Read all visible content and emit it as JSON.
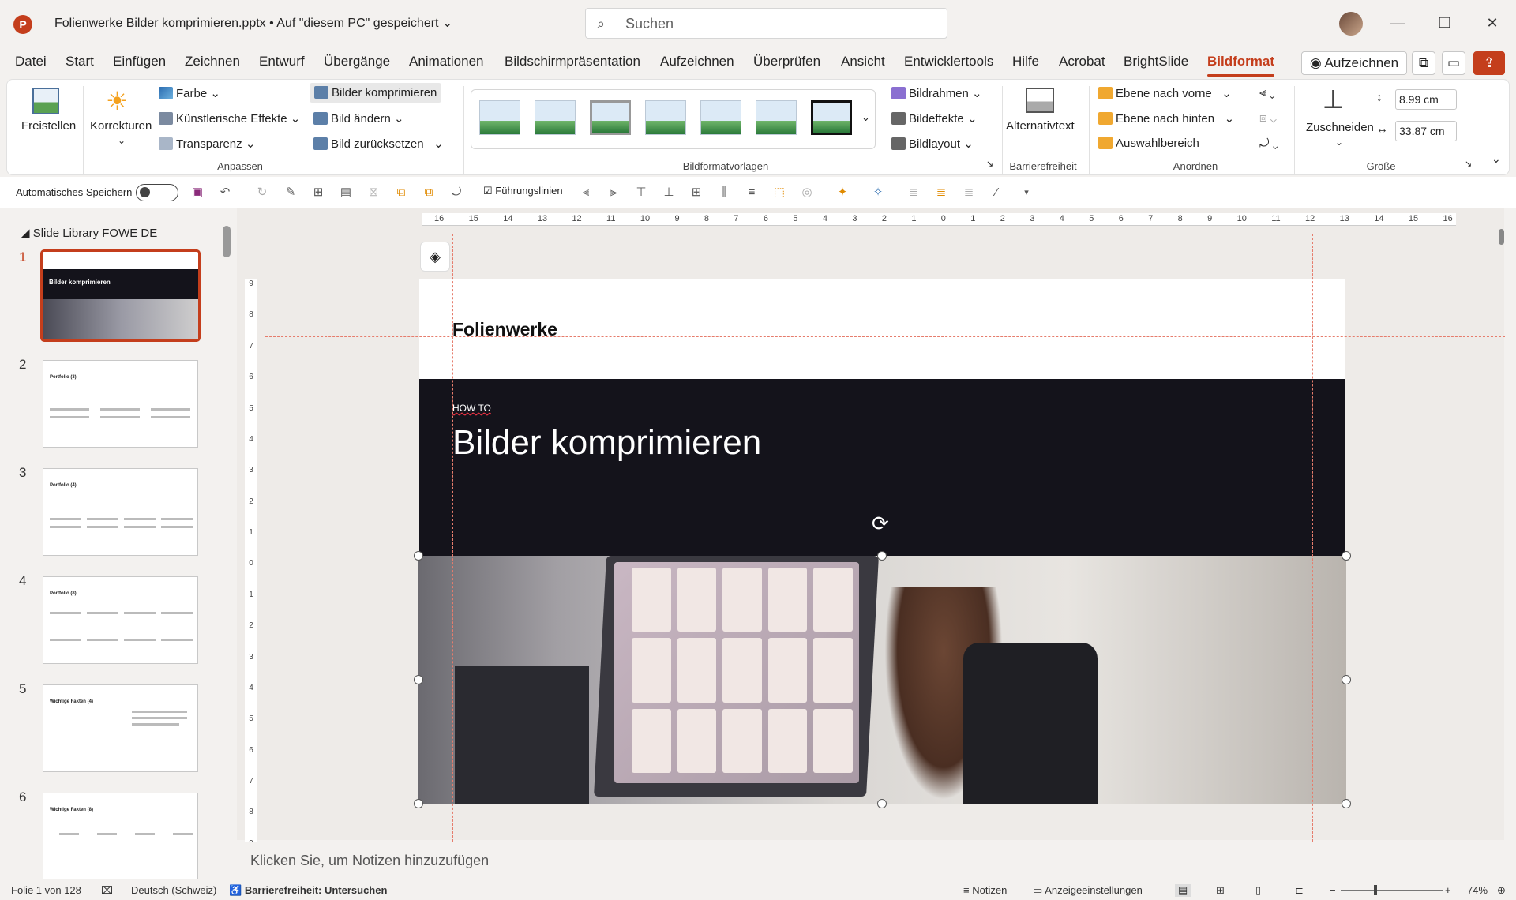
{
  "titlebar": {
    "app_icon": "P",
    "document_title": "Folienwerke Bilder komprimieren.pptx • Auf \"diesem PC\" gespeichert",
    "search_placeholder": "Suchen"
  },
  "tabs": [
    "Datei",
    "Start",
    "Einfügen",
    "Zeichnen",
    "Entwurf",
    "Übergänge",
    "Animationen",
    "Bildschirmpräsentation",
    "Aufzeichnen",
    "Überprüfen",
    "Ansicht",
    "Entwicklertools",
    "Hilfe",
    "Acrobat",
    "BrightSlide",
    "Bildformat"
  ],
  "active_tab": "Bildformat",
  "top_buttons": {
    "record": "Aufzeichnen"
  },
  "ribbon": {
    "freistellen": "Freistellen",
    "korrekturen": "Korrekturen",
    "farbe": "Farbe",
    "kuenstlerisch": "Künstlerische Effekte",
    "transparenz": "Transparenz",
    "bilder_komprimieren": "Bilder komprimieren",
    "bild_aendern": "Bild ändern",
    "bild_zuruecksetzen": "Bild zurücksetzen",
    "group_anpassen": "Anpassen",
    "group_vorlagen": "Bildformatvorlagen",
    "bildrahmen": "Bildrahmen",
    "bildeffekte": "Bildeffekte",
    "bildlayout": "Bildlayout",
    "alternativtext": "Alternativtext",
    "group_barriere": "Barrierefreiheit",
    "ebene_vorne": "Ebene nach vorne",
    "ebene_hinten": "Ebene nach hinten",
    "auswahlbereich": "Auswahlbereich",
    "group_anordnen": "Anordnen",
    "zuschneiden": "Zuschneiden",
    "height": "8.99 cm",
    "width": "33.87 cm",
    "group_groesse": "Größe"
  },
  "qat": {
    "autosave": "Automatisches Speichern",
    "fuehrungslinien": "Führungslinien"
  },
  "ruler": {
    "h_ticks": [
      "16",
      "15",
      "14",
      "13",
      "12",
      "11",
      "10",
      "9",
      "8",
      "7",
      "6",
      "5",
      "4",
      "3",
      "2",
      "1",
      "0",
      "1",
      "2",
      "3",
      "4",
      "5",
      "6",
      "7",
      "8",
      "9",
      "10",
      "11",
      "12",
      "13",
      "14",
      "15",
      "16"
    ],
    "v_ticks": [
      "9",
      "8",
      "7",
      "6",
      "5",
      "4",
      "3",
      "2",
      "1",
      "0",
      "1",
      "2",
      "3",
      "4",
      "5",
      "6",
      "7",
      "8",
      "9"
    ]
  },
  "thumbnails": {
    "library_name": "Slide Library FOWE DE",
    "slides": [
      {
        "num": "1",
        "title": "Bilder komprimieren"
      },
      {
        "num": "2",
        "title": "Portfolio (3)"
      },
      {
        "num": "3",
        "title": "Portfolio (4)"
      },
      {
        "num": "4",
        "title": "Portfolio (8)"
      },
      {
        "num": "5",
        "title": "Wichtige Fakten (4)"
      },
      {
        "num": "6",
        "title": "Wichtige Fakten (8)"
      }
    ]
  },
  "slide": {
    "brand": "Folienwerke",
    "kicker": "HOW TO",
    "title": "Bilder komprimieren"
  },
  "notes_placeholder": "Klicken Sie, um Notizen hinzuzufügen",
  "status": {
    "slide_counter": "Folie 1 von 128",
    "language": "Deutsch (Schweiz)",
    "accessibility": "Barrierefreiheit: Untersuchen",
    "notes": "Notizen",
    "display_settings": "Anzeigeeinstellungen",
    "zoom": "74%"
  },
  "colors": {
    "accent": "#c43e1c",
    "slide_dark": "#14131b"
  }
}
